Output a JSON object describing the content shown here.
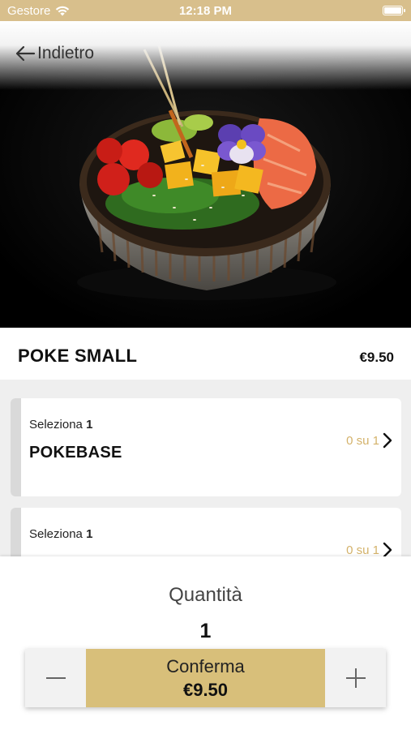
{
  "status_bar": {
    "carrier": "Gestore",
    "time": "12:18 PM"
  },
  "header": {
    "back_label": "Indietro"
  },
  "product": {
    "name": "POKE SMALL",
    "price": "€9.50"
  },
  "options": [
    {
      "select_prefix": "Seleziona",
      "select_count": "1",
      "title": "POKEBASE",
      "progress": "0 su 1"
    },
    {
      "select_prefix": "Seleziona",
      "select_count": "1",
      "title": "",
      "progress": "0 su 1"
    }
  ],
  "quantity": {
    "label": "Quantità",
    "value": "1"
  },
  "actions": {
    "decrease_icon": "minus-icon",
    "confirm_label": "Conferma",
    "confirm_price": "€9.50",
    "increase_icon": "plus-icon"
  },
  "colors": {
    "accent_gold": "#d8bf7a",
    "status_bar": "#d8bf8c",
    "progress_text": "#d4b26a"
  }
}
